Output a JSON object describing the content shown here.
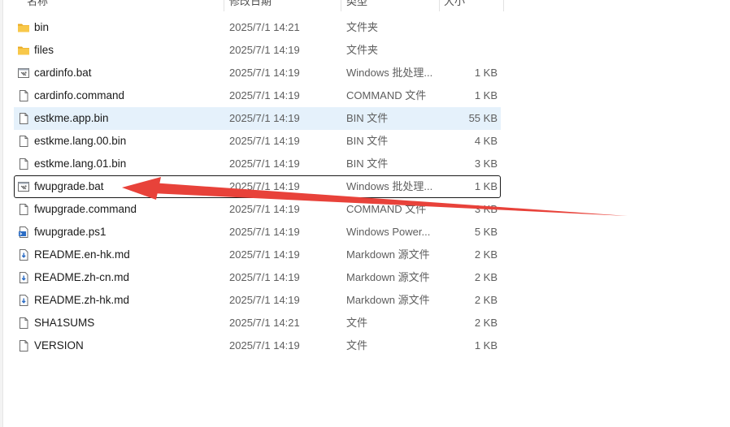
{
  "columns": {
    "name": "名称",
    "date": "修改日期",
    "type": "类型",
    "size": "大小"
  },
  "files": [
    {
      "name": "bin",
      "date": "2025/7/1 14:21",
      "type": "文件夹",
      "size": "",
      "icon": "folder-icon"
    },
    {
      "name": "files",
      "date": "2025/7/1 14:19",
      "type": "文件夹",
      "size": "",
      "icon": "folder-icon"
    },
    {
      "name": "cardinfo.bat",
      "date": "2025/7/1 14:19",
      "type": "Windows 批处理...",
      "size": "1 KB",
      "icon": "batch-file-icon"
    },
    {
      "name": "cardinfo.command",
      "date": "2025/7/1 14:19",
      "type": "COMMAND 文件",
      "size": "1 KB",
      "icon": "file-icon"
    },
    {
      "name": "estkme.app.bin",
      "date": "2025/7/1 14:19",
      "type": "BIN 文件",
      "size": "55 KB",
      "icon": "file-icon"
    },
    {
      "name": "estkme.lang.00.bin",
      "date": "2025/7/1 14:19",
      "type": "BIN 文件",
      "size": "4 KB",
      "icon": "file-icon"
    },
    {
      "name": "estkme.lang.01.bin",
      "date": "2025/7/1 14:19",
      "type": "BIN 文件",
      "size": "3 KB",
      "icon": "file-icon"
    },
    {
      "name": "fwupgrade.bat",
      "date": "2025/7/1 14:19",
      "type": "Windows 批处理...",
      "size": "1 KB",
      "icon": "batch-file-icon"
    },
    {
      "name": "fwupgrade.command",
      "date": "2025/7/1 14:19",
      "type": "COMMAND 文件",
      "size": "3 KB",
      "icon": "file-icon"
    },
    {
      "name": "fwupgrade.ps1",
      "date": "2025/7/1 14:19",
      "type": "Windows Power...",
      "size": "5 KB",
      "icon": "powershell-file-icon"
    },
    {
      "name": "README.en-hk.md",
      "date": "2025/7/1 14:19",
      "type": "Markdown 源文件",
      "size": "2 KB",
      "icon": "markdown-file-icon"
    },
    {
      "name": "README.zh-cn.md",
      "date": "2025/7/1 14:19",
      "type": "Markdown 源文件",
      "size": "2 KB",
      "icon": "markdown-file-icon"
    },
    {
      "name": "README.zh-hk.md",
      "date": "2025/7/1 14:19",
      "type": "Markdown 源文件",
      "size": "2 KB",
      "icon": "markdown-file-icon"
    },
    {
      "name": "SHA1SUMS",
      "date": "2025/7/1 14:21",
      "type": "文件",
      "size": "2 KB",
      "icon": "file-icon"
    },
    {
      "name": "VERSION",
      "date": "2025/7/1 14:19",
      "type": "文件",
      "size": "1 KB",
      "icon": "file-icon"
    }
  ],
  "colors": {
    "selected_row_bg": "#e5f1fb",
    "annotation_arrow": "#e8423a",
    "folder": "#f6c343"
  }
}
